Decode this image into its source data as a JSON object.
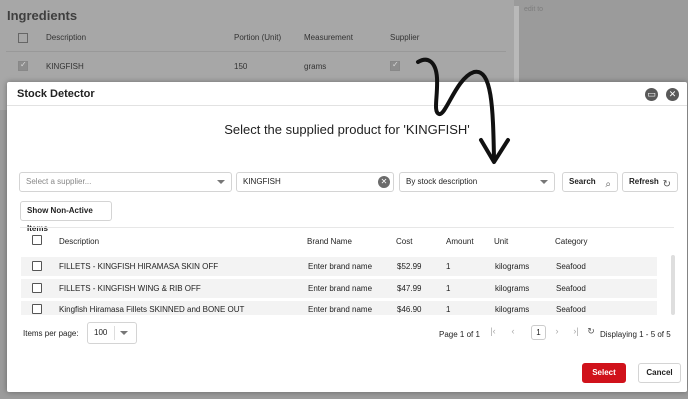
{
  "background": {
    "title": "Ingredients",
    "columns": [
      "Description",
      "Portion (Unit)",
      "Measurement",
      "Supplier"
    ],
    "row": {
      "description": "KINGFISH",
      "portion": "150",
      "measurement": "grams"
    },
    "right_text": "edit to"
  },
  "modal": {
    "title": "Stock Detector",
    "heading": "Select the supplied product for 'KINGFISH'",
    "minimize_icon": "window-icon",
    "close_icon": "close-icon"
  },
  "search": {
    "supplier_placeholder": "Select a supplier...",
    "term_value": "KINGFISH",
    "mode_value": "By stock description",
    "search_label": "Search",
    "refresh_label": "Refresh",
    "non_active_label": "Show Non-Active Items"
  },
  "table": {
    "columns": [
      "Description",
      "Brand Name",
      "Cost",
      "Amount",
      "Unit",
      "Category"
    ],
    "rows": [
      {
        "description": "FILLETS - KINGFISH HIRAMASA SKIN OFF",
        "brand": "Enter brand name",
        "cost": "$52.99",
        "amount": "1",
        "unit": "kilograms",
        "category": "Seafood"
      },
      {
        "description": "FILLETS - KINGFISH WING & RIB OFF",
        "brand": "Enter brand name",
        "cost": "$47.99",
        "amount": "1",
        "unit": "kilograms",
        "category": "Seafood"
      },
      {
        "description": "Kingfish Hiramasa Fillets SKINNED and BONE OUT",
        "brand": "Enter brand name",
        "cost": "$46.90",
        "amount": "1",
        "unit": "kilograms",
        "category": "Seafood"
      }
    ]
  },
  "footer": {
    "items_per_page_label": "Items per page:",
    "items_per_page_value": "100",
    "page_info": "Page 1 of 1",
    "current_page": "1",
    "displaying": "Displaying 1 - 5 of 5",
    "select_label": "Select",
    "cancel_label": "Cancel"
  },
  "colors": {
    "accent": "#d0121b",
    "row_bg": "#f3f3f3"
  }
}
